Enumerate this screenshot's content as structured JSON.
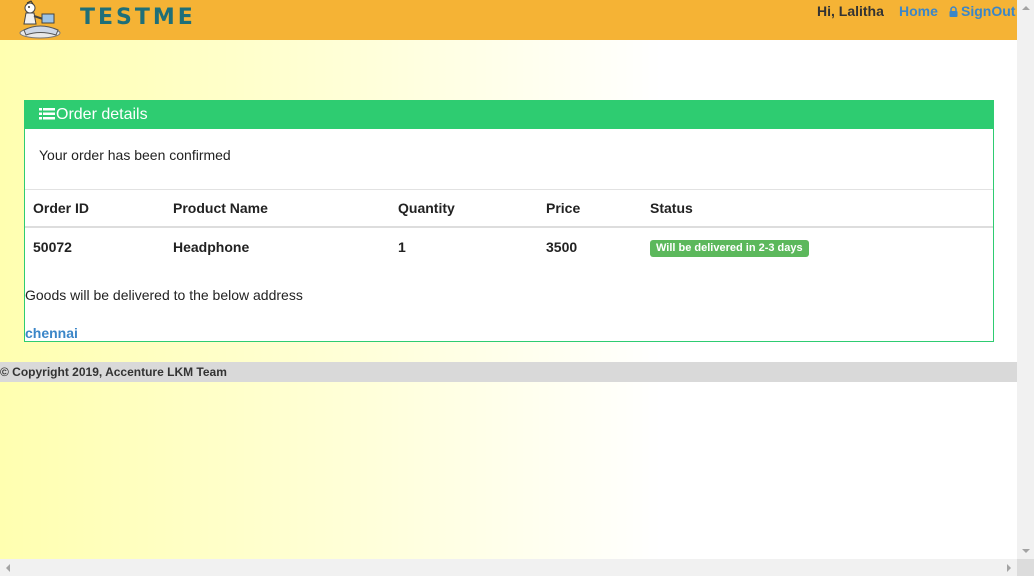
{
  "header": {
    "logo_text": "TESTME",
    "greeting": "Hi, Lalitha",
    "home_link": "Home",
    "signout_link": "SignOut",
    "background_color": "#f5b335"
  },
  "panel": {
    "title": "Order details",
    "confirmation": "Your order has been confirmed",
    "accent_color": "#2ecc71",
    "table": {
      "headers": [
        "Order ID",
        "Product Name",
        "Quantity",
        "Price",
        "Status"
      ],
      "rows": [
        {
          "order_id": "50072",
          "product_name": "Headphone",
          "quantity": "1",
          "price": "3500",
          "status": "Will be delivered in 2-3 days"
        }
      ]
    },
    "delivery_note": "Goods will be delivered to the below address",
    "address": "chennai"
  },
  "footer": {
    "text": "© Copyright 2019, Accenture LKM Team"
  },
  "icons": {
    "mascot": "mascot-logo-icon",
    "lock": "lock-icon",
    "list": "list-icon"
  }
}
